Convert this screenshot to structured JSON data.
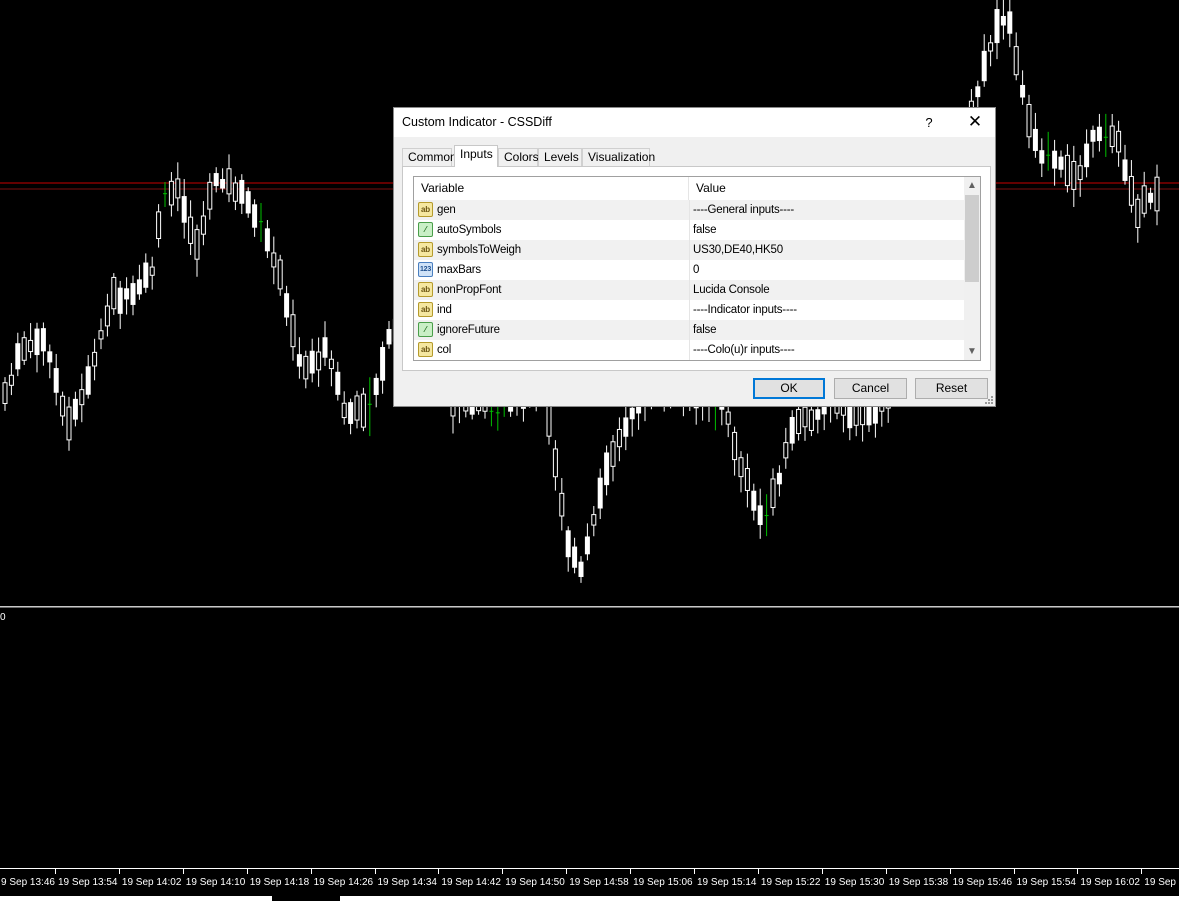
{
  "window": {
    "title": "Custom Indicator - CSSDiff",
    "help_label": "?",
    "close_label": "✕"
  },
  "tabs": [
    {
      "label": "Common",
      "active": false
    },
    {
      "label": "Inputs",
      "active": true
    },
    {
      "label": "Colors",
      "active": false
    },
    {
      "label": "Levels",
      "active": false
    },
    {
      "label": "Visualization",
      "active": false
    }
  ],
  "grid": {
    "columns": [
      "Variable",
      "Value"
    ],
    "rows": [
      {
        "type": "string",
        "icon_text": "ab",
        "name": "gen",
        "value": "----General inputs----"
      },
      {
        "type": "bool",
        "icon_text": "⁄",
        "name": "autoSymbols",
        "value": "false"
      },
      {
        "type": "string",
        "icon_text": "ab",
        "name": "symbolsToWeigh",
        "value": "US30,DE40,HK50"
      },
      {
        "type": "number",
        "icon_text": "123",
        "name": "maxBars",
        "value": "0"
      },
      {
        "type": "string",
        "icon_text": "ab",
        "name": "nonPropFont",
        "value": "Lucida Console"
      },
      {
        "type": "string",
        "icon_text": "ab",
        "name": "ind",
        "value": "----Indicator inputs----"
      },
      {
        "type": "bool",
        "icon_text": "⁄",
        "name": "ignoreFuture",
        "value": "false"
      },
      {
        "type": "string",
        "icon_text": "ab",
        "name": "col",
        "value": "----Colo(u)r inputs----"
      }
    ],
    "scroll_up_icon": "▲",
    "scroll_down_icon": "▼"
  },
  "buttons": {
    "ok": "OK",
    "cancel": "Cancel",
    "reset": "Reset"
  },
  "chart": {
    "subwindow_value_label": "0",
    "time_labels": [
      "9 Sep 13:46",
      "19 Sep 13:54",
      "19 Sep 14:02",
      "19 Sep 14:10",
      "19 Sep 14:18",
      "19 Sep 14:26",
      "19 Sep 14:34",
      "19 Sep 14:42",
      "19 Sep 14:50",
      "19 Sep 14:58",
      "19 Sep 15:06",
      "19 Sep 15:14",
      "19 Sep 15:22",
      "19 Sep 15:30",
      "19 Sep 15:38",
      "19 Sep 15:46",
      "19 Sep 15:54",
      "19 Sep 16:02",
      "19 Sep"
    ],
    "colors": {
      "background": "#000000",
      "candle": "#ffffff",
      "doji": "#00c000",
      "level_line": "#c80000"
    }
  }
}
